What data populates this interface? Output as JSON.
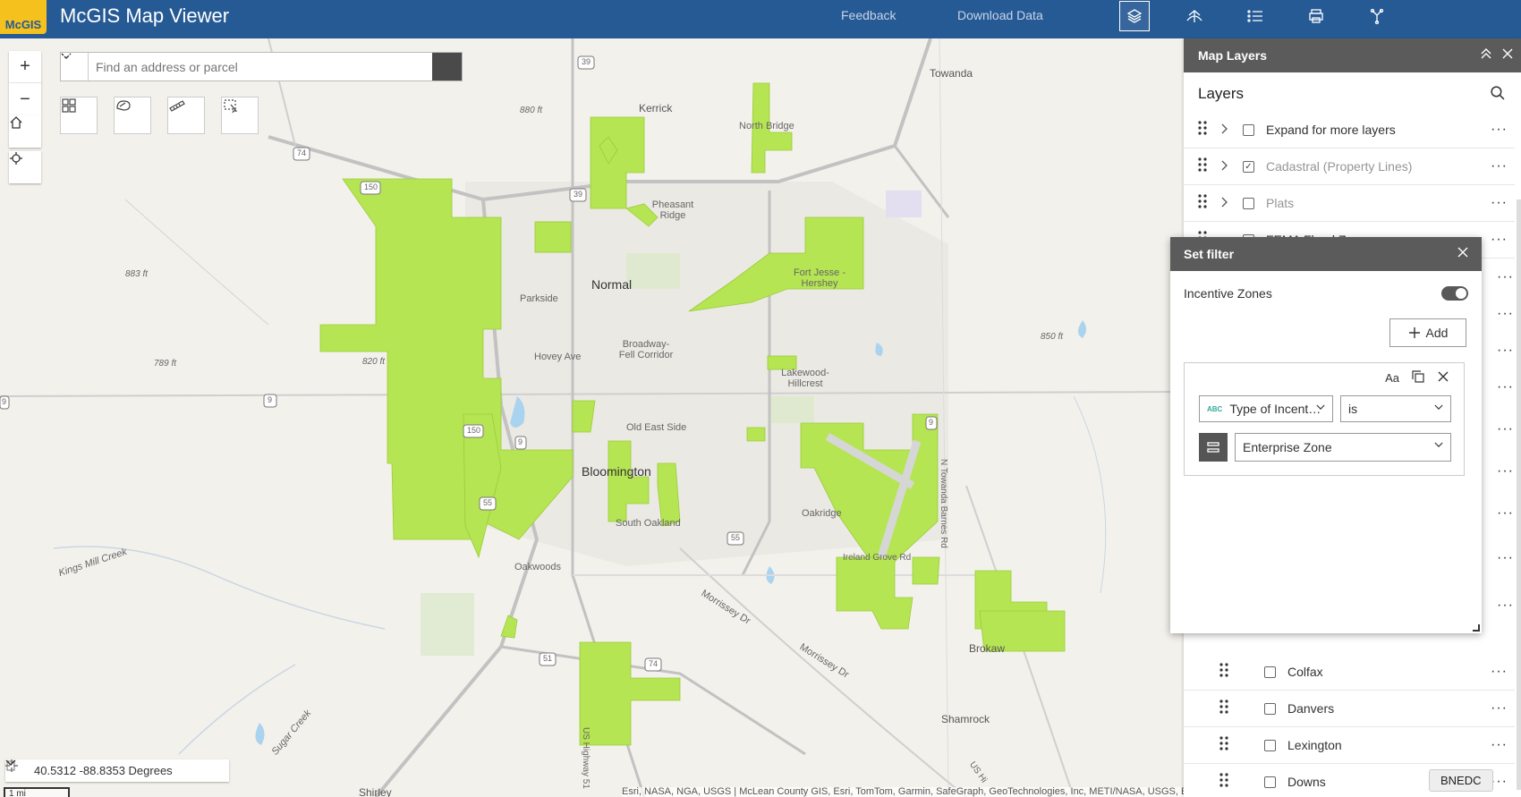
{
  "header": {
    "logo_text": "McGIS",
    "title": "McGIS Map Viewer",
    "feedback_label": "Feedback",
    "download_label": "Download Data",
    "icons": [
      "layers-icon",
      "basemap-icon",
      "legend-icon",
      "print-icon",
      "tools-icon"
    ]
  },
  "search": {
    "placeholder": "Find an address or parcel"
  },
  "map": {
    "zoom_in": "+",
    "zoom_out": "−",
    "labels": {
      "towanda": "Towanda",
      "kerrick": "Kerrick",
      "north_bridge": "North Bridge",
      "pheasant_ridge": "Pheasant Ridge",
      "normal": "Normal",
      "parkside": "Parkside",
      "fort_jesse": "Fort Jesse - Hershey",
      "hovey_ave": "Hovey Ave",
      "broadway": "Broadway-Fell Corridor",
      "lakewood": "Lakewood-Hillcrest",
      "old_east_side": "Old East Side",
      "bloomington": "Bloomington",
      "south_oakland": "South Oakland",
      "oakridge": "Oakridge",
      "oakwoods": "Oakwoods",
      "ireland_grove": "Ireland Grove Rd",
      "morrissey_dr": "Morrissey Dr",
      "morrissey_dr2": "Morrissey Dr",
      "brokaw": "Brokaw",
      "shamrock": "Shamrock",
      "shirley": "Shirley",
      "kings_mill": "Kings Mill Creek",
      "sugar_creek": "Sugar Creek",
      "us_highway": "US Highway 51",
      "towanda_barnes": "N Towanda Barnes Rd",
      "us_hwy_right": "US Hi",
      "elev_880": "880 ft",
      "elev_883": "883 ft",
      "elev_789": "789 ft",
      "elev_820": "820 ft",
      "elev_850": "850 ft",
      "shield_39a": "39",
      "shield_39b": "39",
      "shield_74a": "74",
      "shield_150a": "150",
      "shield_150b": "150",
      "shield_9a": "9",
      "shield_9b": "9",
      "shield_55a": "55",
      "shield_55b": "55",
      "shield_51": "51",
      "shield_74b": "74",
      "shield_9c": "9",
      "shield_9d": "9"
    },
    "coordinates": "40.5312 -88.8353 Degrees",
    "scale": "1 mi",
    "attribution": "Esri, NASA, NGA, USGS | McLean County GIS, Esri, TomTom, Garmin, SafeGraph, GeoTechnologies, Inc, METI/NASA, USGS, EPA, NPS, USDA",
    "zone_color": "#b5e553"
  },
  "panel": {
    "header_title": "Map Layers",
    "layers_title": "Layers",
    "layers": [
      {
        "name": "Expand for more layers",
        "checked": false,
        "dim": false
      },
      {
        "name": "Cadastral (Property Lines)",
        "checked": true,
        "dim": true
      },
      {
        "name": "Plats",
        "checked": false,
        "dim": true
      },
      {
        "name": "FEMA Flood Z",
        "checked": false,
        "dim": false
      }
    ],
    "sublayers": [
      {
        "name": "Colfax"
      },
      {
        "name": "Danvers"
      },
      {
        "name": "Lexington"
      },
      {
        "name": "Downs"
      }
    ],
    "bnedc_label": "BNEDC"
  },
  "filter": {
    "title": "Set filter",
    "layer_name": "Incentive Zones",
    "add_label": "Add",
    "case_label": "Aa",
    "field_value": "Type of Incent…",
    "operator_value": "is",
    "value": "Enterprise Zone",
    "field_type": "ABC"
  }
}
